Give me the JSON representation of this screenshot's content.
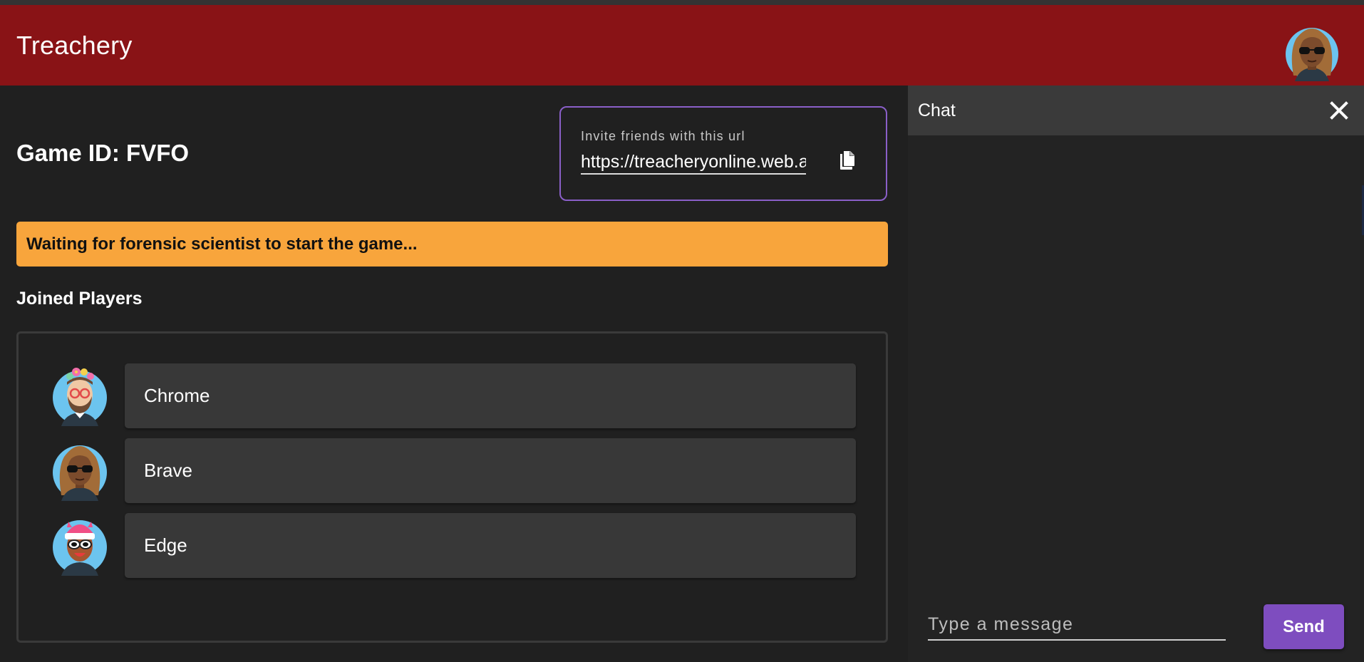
{
  "header": {
    "title": "Treachery",
    "avatar_icon": "user-avatar-sunglasses",
    "background_color": "#891316"
  },
  "game": {
    "id_label": "Game ID: FVFO"
  },
  "invite": {
    "label": "Invite friends with this url",
    "url": "https://treacheryonline.web.app",
    "copy_icon": "copy-icon",
    "border_color": "#8a5fc8"
  },
  "status": {
    "message": "Waiting for forensic scientist to start the game...",
    "color": "#f8a53c"
  },
  "players": {
    "title": "Joined Players",
    "items": [
      {
        "name": "Chrome",
        "avatar": "avatar-bearded-flower-crown"
      },
      {
        "name": "Brave",
        "avatar": "avatar-sunglasses-long-hair"
      },
      {
        "name": "Edge",
        "avatar": "avatar-pink-beanie-sunglasses"
      }
    ]
  },
  "chat": {
    "title": "Chat",
    "close_icon": "close-icon",
    "placeholder": "Type a message",
    "send_label": "Send",
    "send_color": "#7e4dbf"
  }
}
